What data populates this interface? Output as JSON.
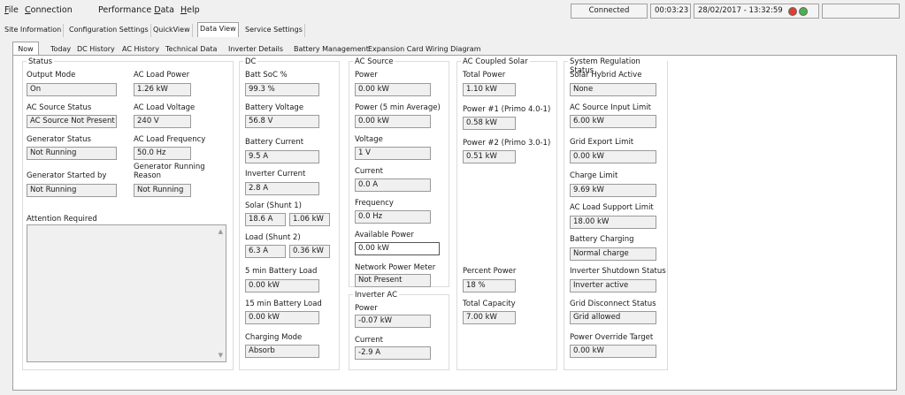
{
  "menu": {
    "file": {
      "u": "F",
      "rest": "ile"
    },
    "connection": {
      "u": "C",
      "rest": "onnection"
    },
    "performance": {
      "pre": "Performance ",
      "u": "D",
      "rest": "ata"
    },
    "help": {
      "u": "H",
      "rest": "elp"
    }
  },
  "status": {
    "connection": "Connected",
    "elapsed": "00:03:23",
    "datetime": "28/02/2017 - 13:32:59",
    "indicator_colors": {
      "red": "#e03c31",
      "green": "#4caf50"
    }
  },
  "main_tabs": [
    "Site Information",
    "Configuration Settings",
    "QuickView",
    "Data View",
    "Service Settings"
  ],
  "sub_tabs": [
    "Now",
    "Today",
    "DC History",
    "AC History",
    "Technical Data",
    "Inverter Details",
    "Battery Management",
    "Expansion Card Wiring Diagram"
  ],
  "status_panel": {
    "title": "Status",
    "output_mode": {
      "label": "Output Mode",
      "value": "On"
    },
    "ac_load_power": {
      "label": "AC Load Power",
      "value": "1.26 kW"
    },
    "ac_source_status": {
      "label": "AC Source Status",
      "value": "AC Source Not Present"
    },
    "ac_load_voltage": {
      "label": "AC Load Voltage",
      "value": "240 V"
    },
    "generator_status": {
      "label": "Generator Status",
      "value": "Not Running"
    },
    "ac_load_frequency": {
      "label": "AC Load Frequency",
      "value": "50.0 Hz"
    },
    "generator_started_by": {
      "label": "Generator Started by",
      "value": "Not Running"
    },
    "generator_running_reason": {
      "label1": "Generator Running",
      "label2": "Reason",
      "value": "Not Running"
    },
    "attention_required": {
      "label": "Attention Required"
    }
  },
  "dc_panel": {
    "title": "DC",
    "batt_soc": {
      "label": "Batt SoC %",
      "value": "99.3 %"
    },
    "battery_voltage": {
      "label": "Battery Voltage",
      "value": "56.8 V"
    },
    "battery_current": {
      "label": "Battery Current",
      "value": "9.5 A"
    },
    "inverter_current": {
      "label": "Inverter Current",
      "value": "2.8 A"
    },
    "solar_shunt1": {
      "label": "Solar (Shunt 1)",
      "current": "18.6 A",
      "power": "1.06 kW"
    },
    "load_shunt2": {
      "label": "Load (Shunt 2)",
      "current": "6.3 A",
      "power": "0.36 kW"
    },
    "battery_load_5min": {
      "label": "5 min Battery Load",
      "value": "0.00 kW"
    },
    "battery_load_15min": {
      "label": "15 min Battery Load",
      "value": "0.00 kW"
    },
    "charging_mode": {
      "label": "Charging Mode",
      "value": "Absorb"
    }
  },
  "ac_source_panel": {
    "title": "AC Source",
    "power": {
      "label": "Power",
      "value": "0.00 kW"
    },
    "power_5min": {
      "label": "Power (5 min Average)",
      "value": "0.00 kW"
    },
    "voltage": {
      "label": "Voltage",
      "value": "1 V"
    },
    "current": {
      "label": "Current",
      "value": "0.0 A"
    },
    "frequency": {
      "label": "Frequency",
      "value": "0.0 Hz"
    },
    "available_power": {
      "label": "Available Power",
      "value": "0.00 kW"
    },
    "network_power_meter": {
      "label": "Network Power Meter",
      "value": "Not Present"
    }
  },
  "inverter_ac_panel": {
    "title": "Inverter AC",
    "power": {
      "label": "Power",
      "value": "-0.07 kW"
    },
    "current": {
      "label": "Current",
      "value": "-2.9 A"
    }
  },
  "ac_coupled_panel": {
    "title": "AC Coupled Solar",
    "total_power": {
      "label": "Total Power",
      "value": "1.10 kW"
    },
    "power1": {
      "label": "Power #1 (Primo 4.0-1)",
      "value": "0.58 kW"
    },
    "power2": {
      "label": "Power #2 (Primo 3.0-1)",
      "value": "0.51 kW"
    },
    "percent_power": {
      "label": "Percent Power",
      "value": "18 %"
    },
    "total_capacity": {
      "label": "Total Capacity",
      "value": "7.00 kW"
    }
  },
  "system_regulation_panel": {
    "title": "System Regulation Status",
    "solar_hybrid_active": {
      "label": "Solar Hybrid Active",
      "value": "None"
    },
    "ac_source_input_limit": {
      "label": "AC Source Input Limit",
      "value": "6.00 kW"
    },
    "grid_export_limit": {
      "label": "Grid Export Limit",
      "value": "0.00 kW"
    },
    "charge_limit": {
      "label": "Charge Limit",
      "value": "9.69 kW"
    },
    "ac_load_support_limit": {
      "label": "AC Load Support Limit",
      "value": "18.00 kW"
    },
    "battery_charging": {
      "label": "Battery Charging",
      "value": "Normal charge"
    },
    "inverter_shutdown_status": {
      "label": "Inverter Shutdown Status",
      "value": "Inverter active"
    },
    "grid_disconnect_status": {
      "label": "Grid Disconnect Status",
      "value": "Grid allowed"
    },
    "power_override_target": {
      "label": "Power Override Target",
      "value": "0.00 kW"
    }
  }
}
